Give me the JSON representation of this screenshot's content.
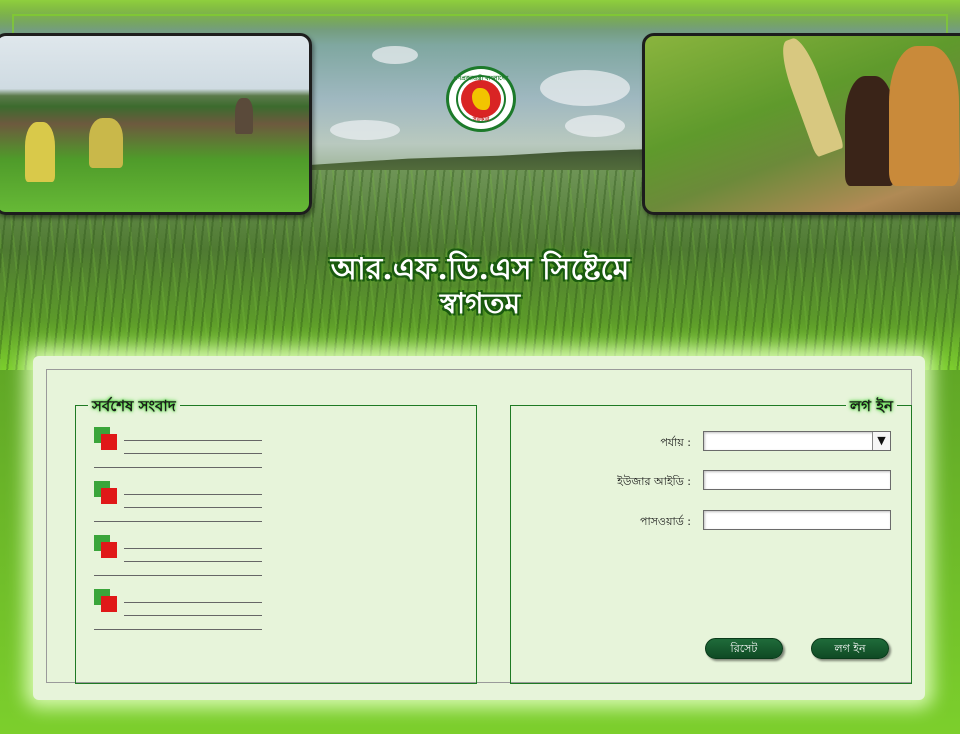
{
  "header": {
    "welcome_line1": "আর.এফ.ডি.এস সিষ্টেমে",
    "welcome_line2": "স্বাগতম"
  },
  "emblem": {
    "top_text": "গণপ্রজাতন্ত্রী বাংলাদেশ",
    "bottom_text": "সরকার"
  },
  "news": {
    "title": "সর্বশেষ সংবাদ",
    "items": [
      "",
      "",
      "",
      ""
    ]
  },
  "login": {
    "title": "লগ ইন",
    "level_label": "পর্যায় :",
    "level_value": "",
    "user_label": "ইউজার আইডি :",
    "user_value": "",
    "password_label": "পাসওয়ার্ড :",
    "password_value": "",
    "reset_label": "রিসেট",
    "login_label": "লগ ইন"
  },
  "colors": {
    "accent_green": "#1f7a23",
    "button_green": "#0f4a24",
    "panel_bg": "#e7f4da",
    "icon_red": "#e01818",
    "icon_green": "#3aa53a"
  }
}
